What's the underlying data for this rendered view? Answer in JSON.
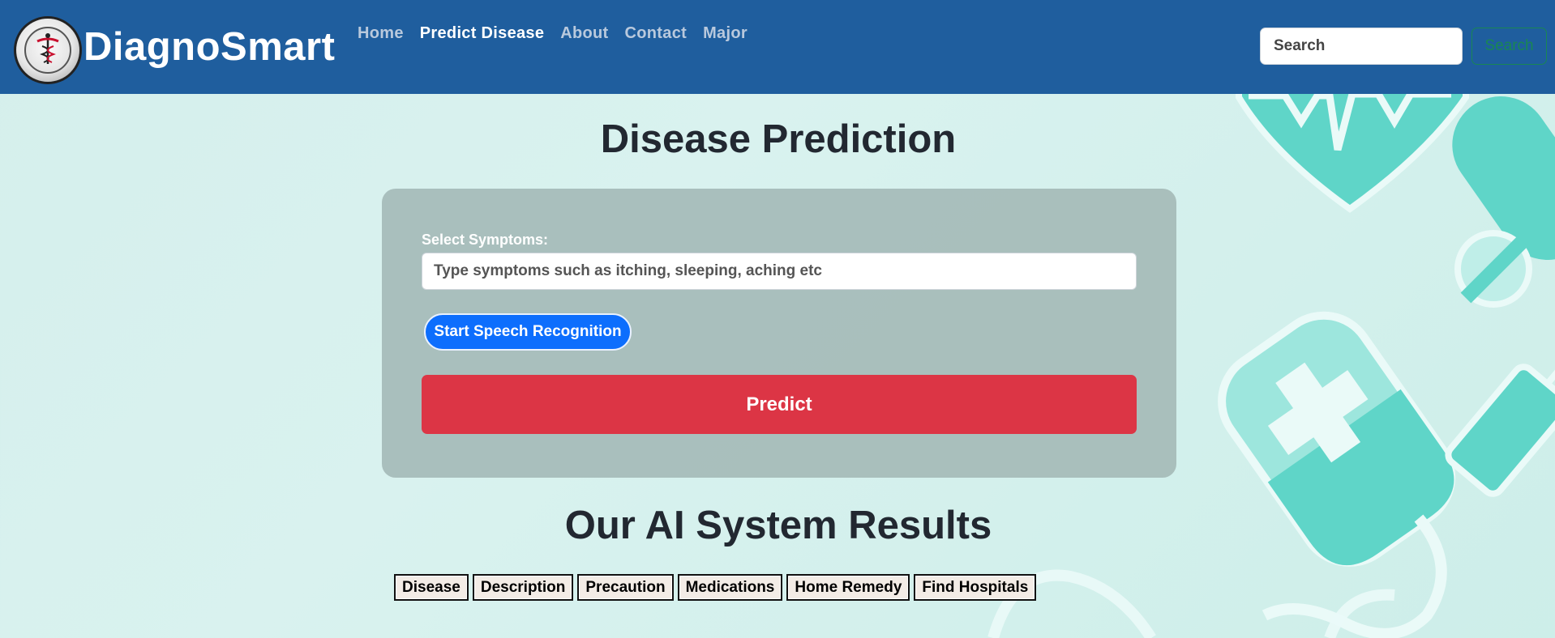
{
  "header": {
    "brand": "DiagnoSmart",
    "logo_icon": "caduceus-logo-icon",
    "nav": [
      {
        "label": "Home",
        "active": false
      },
      {
        "label": "Predict Disease",
        "active": true
      },
      {
        "label": "About",
        "active": false
      },
      {
        "label": "Contact",
        "active": false
      },
      {
        "label": "Major",
        "active": false
      }
    ],
    "search": {
      "placeholder": "Search",
      "button_label": "Search"
    }
  },
  "main": {
    "title": "Disease Prediction",
    "form": {
      "symptoms_label": "Select Symptoms:",
      "symptoms_placeholder": "Type symptoms such as itching, sleeping, aching etc",
      "speech_button_label": "Start Speech Recognition",
      "predict_button_label": "Predict"
    },
    "results": {
      "title": "Our AI System Results",
      "tabs": [
        "Disease",
        "Description",
        "Precaution",
        "Medications",
        "Home Remedy",
        "Find Hospitals"
      ]
    }
  },
  "colors": {
    "navbar": "#1f5e9e",
    "predict_button": "#dc3545",
    "speech_button": "#0d6efd",
    "search_button": "#198754",
    "card": "#a7bcb9",
    "background": "#d5efec",
    "decor": "#5fd5c8"
  }
}
